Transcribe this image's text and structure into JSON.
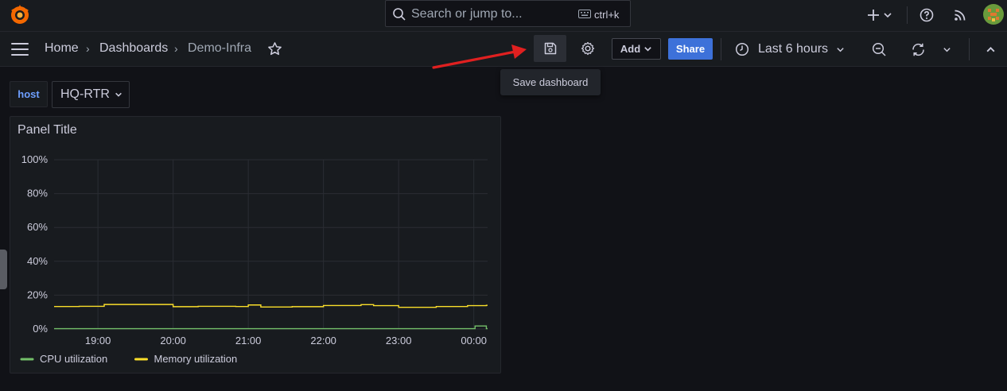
{
  "search": {
    "placeholder": "Search or jump to...",
    "shortcut": "ctrl+k"
  },
  "breadcrumb": {
    "home": "Home",
    "dashboards": "Dashboards",
    "current": "Demo-Infra",
    "separator": "›"
  },
  "toolbar": {
    "add_label": "Add",
    "share_label": "Share",
    "time_range": "Last 6 hours",
    "save_tooltip": "Save dashboard"
  },
  "variables": {
    "label": "host",
    "value": "HQ-RTR"
  },
  "panel": {
    "title": "Panel Title"
  },
  "colors": {
    "accent": "#3d71d9",
    "annotation_arrow": "#e02020",
    "cpu": "#73bf69",
    "memory": "#fade2a"
  },
  "chart_data": {
    "type": "line",
    "title": "Panel Title",
    "y_ticks": [
      "100%",
      "80%",
      "60%",
      "40%",
      "20%",
      "0%"
    ],
    "x_ticks": [
      "19:00",
      "20:00",
      "21:00",
      "22:00",
      "23:00",
      "00:00"
    ],
    "ylim": [
      0,
      100
    ],
    "grid": true,
    "legend_placement": "bottom-left",
    "series": [
      {
        "name": "CPU utilization",
        "color": "#73bf69",
        "x": [
          "18:25",
          "19:00",
          "19:30",
          "20:00",
          "20:30",
          "21:00",
          "21:30",
          "22:00",
          "22:30",
          "23:00",
          "23:30",
          "00:00",
          "00:01",
          "00:10"
        ],
        "values": [
          0.2,
          0.2,
          0.2,
          0.2,
          0.2,
          0.2,
          0.2,
          0.2,
          0.2,
          0.2,
          0.2,
          0.2,
          1.8,
          0.2
        ]
      },
      {
        "name": "Memory utilization",
        "color": "#fade2a",
        "x": [
          "18:25",
          "18:45",
          "19:05",
          "19:30",
          "19:55",
          "20:00",
          "20:20",
          "20:50",
          "21:00",
          "21:10",
          "21:35",
          "22:00",
          "22:30",
          "22:40",
          "23:00",
          "23:30",
          "23:55",
          "00:10"
        ],
        "values": [
          13.3,
          13.4,
          14.5,
          14.5,
          14.5,
          13.2,
          13.4,
          13.3,
          14.2,
          13.0,
          13.2,
          13.9,
          14.4,
          13.8,
          12.8,
          13.3,
          13.8,
          14.0
        ]
      }
    ]
  }
}
